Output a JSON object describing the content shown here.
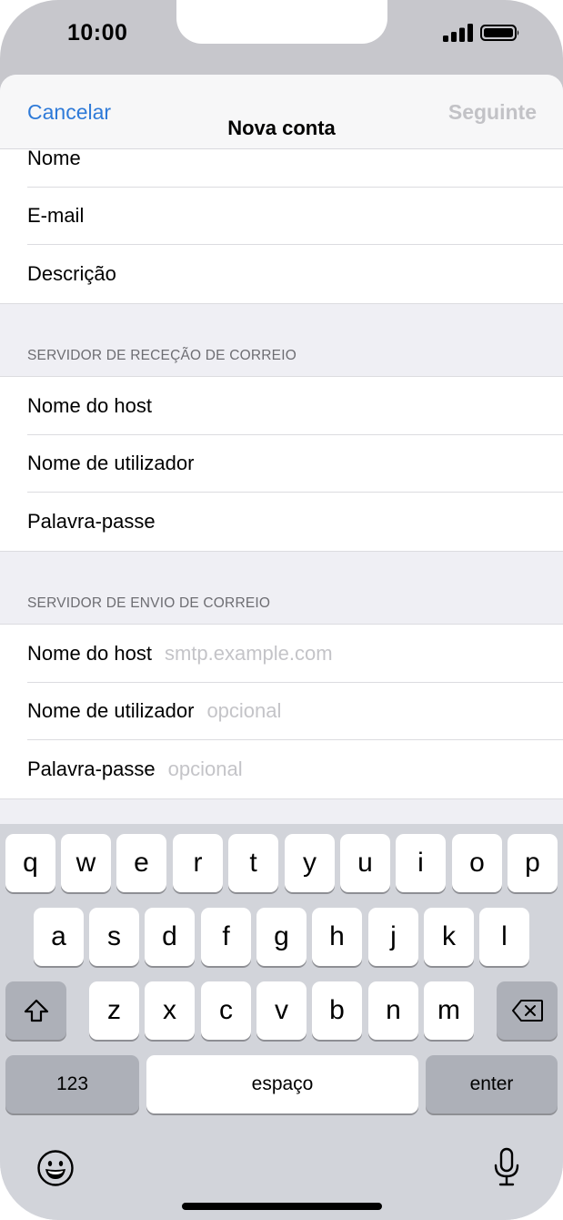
{
  "status": {
    "time": "10:00",
    "icons": [
      "signal-icon",
      "battery-icon"
    ]
  },
  "nav": {
    "cancel": "Cancelar",
    "title": "Nova conta",
    "next": "Seguinte"
  },
  "account": {
    "rows": [
      {
        "label": "Nome"
      },
      {
        "label": "E-mail"
      },
      {
        "label": "Descrição"
      }
    ]
  },
  "incoming": {
    "header": "SERVIDOR DE RECEÇÃO DE CORREIO",
    "rows": [
      {
        "label": "Nome do host"
      },
      {
        "label": "Nome de utilizador"
      },
      {
        "label": "Palavra-passe"
      }
    ]
  },
  "outgoing": {
    "header": "SERVIDOR DE ENVIO DE CORREIO",
    "rows": [
      {
        "label": "Nome do host",
        "placeholder": "smtp.example.com"
      },
      {
        "label": "Nome de utilizador",
        "placeholder": "opcional"
      },
      {
        "label": "Palavra-passe",
        "placeholder": "opcional"
      }
    ]
  },
  "keyboard": {
    "row1": [
      "q",
      "w",
      "e",
      "r",
      "t",
      "y",
      "u",
      "i",
      "o",
      "p"
    ],
    "row2": [
      "a",
      "s",
      "d",
      "f",
      "g",
      "h",
      "j",
      "k",
      "l"
    ],
    "row3": [
      "z",
      "x",
      "c",
      "v",
      "b",
      "n",
      "m"
    ],
    "numbers": "123",
    "space": "espaço",
    "enter": "enter",
    "icons": [
      "shift-icon",
      "backspace-icon",
      "emoji-icon",
      "microphone-icon"
    ]
  }
}
